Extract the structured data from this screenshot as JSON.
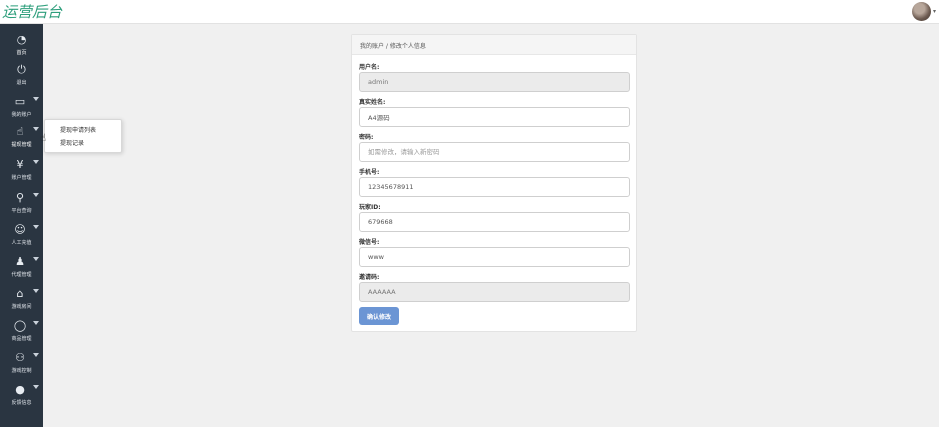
{
  "header": {
    "brand": "运营后台"
  },
  "sidebar": {
    "items": [
      {
        "label": "首页",
        "icon": "dashboard-icon",
        "glyph": "◔"
      },
      {
        "label": "退出",
        "icon": "power-icon",
        "glyph": "⏻"
      },
      {
        "label": "我的账户",
        "icon": "monitor-icon",
        "glyph": "▭"
      },
      {
        "label": "提现管理",
        "icon": "hand-pointer-icon",
        "glyph": "☝"
      },
      {
        "label": "账户管理",
        "icon": "yen-icon",
        "glyph": "¥"
      },
      {
        "label": "平台查询",
        "icon": "search-icon",
        "glyph": "⚲"
      },
      {
        "label": "人工充值",
        "icon": "smiley-icon",
        "glyph": "☺"
      },
      {
        "label": "代理管理",
        "icon": "person-icon",
        "glyph": "♟"
      },
      {
        "label": "游戏房间",
        "icon": "home-icon",
        "glyph": "⌂"
      },
      {
        "label": "商品管理",
        "icon": "comment-icon",
        "glyph": "◯"
      },
      {
        "label": "游戏控制",
        "icon": "users-icon",
        "glyph": "⚇"
      },
      {
        "label": "反馈信息",
        "icon": "chat-icon",
        "glyph": "●"
      }
    ]
  },
  "flyout": {
    "items": [
      "提现申请列表",
      "提现记录"
    ]
  },
  "breadcrumb": "我的账户 / 修改个人信息",
  "form": {
    "username": {
      "label": "用户名:",
      "value": "admin"
    },
    "realname": {
      "label": "真实姓名:",
      "value": "A4源码"
    },
    "password": {
      "label": "密码:",
      "placeholder": "如需修改，请输入新密码"
    },
    "phone": {
      "label": "手机号:",
      "value": "12345678911"
    },
    "player_id": {
      "label": "玩家ID:",
      "value": "679668"
    },
    "wechat": {
      "label": "微信号:",
      "value": "www"
    },
    "invite_code": {
      "label": "邀请码:",
      "value": "AAAAAA"
    },
    "submit_label": "确认修改"
  },
  "colors": {
    "sidebar": "#2a3541",
    "brand": "#2d9e7b",
    "primary_button": "#6b95d4"
  }
}
